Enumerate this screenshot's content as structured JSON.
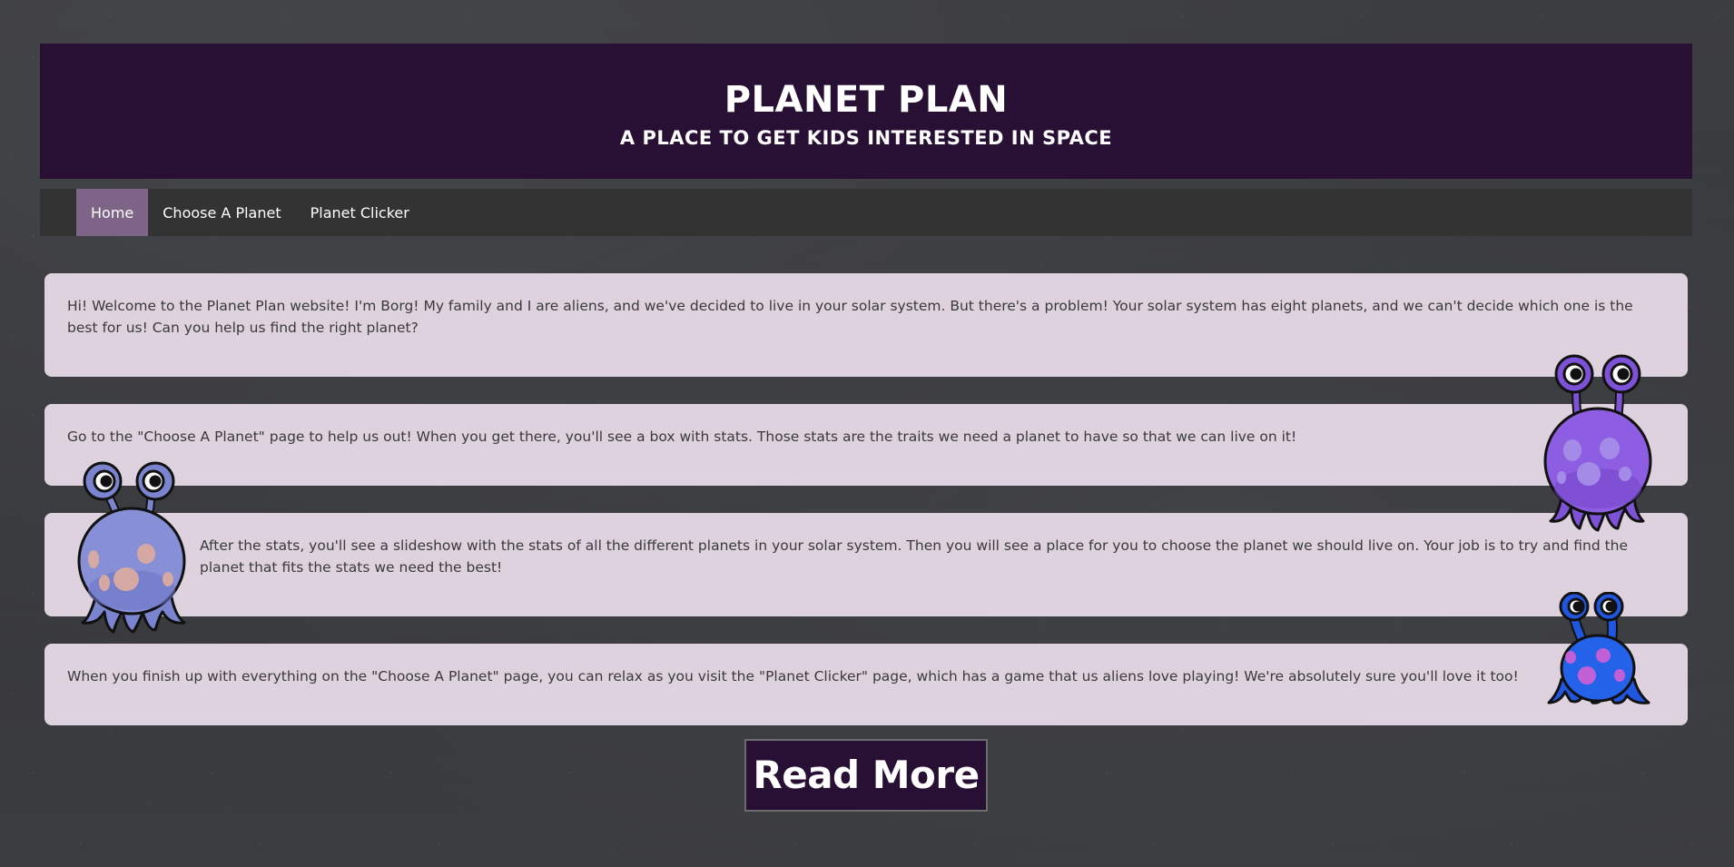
{
  "header": {
    "title": "PLANET PLAN",
    "subtitle": "A PLACE TO GET KIDS INTERESTED IN SPACE"
  },
  "nav": {
    "items": [
      {
        "label": "Home",
        "active": true
      },
      {
        "label": "Choose A Planet",
        "active": false
      },
      {
        "label": "Planet Clicker",
        "active": false
      }
    ]
  },
  "content": {
    "paragraphs": [
      "Hi! Welcome to the Planet Plan website! I'm Borg! My family and I are aliens, and we've decided to live in your solar system. But there's a problem! Your solar system has eight planets, and we can't decide which one is the best for us! Can you help us find the right planet?",
      "Go to the \"Choose A Planet\" page to help us out! When you get there, you'll see a box with stats. Those stats are the traits we need a planet to have so that we can live on it!",
      "After the stats, you'll see a slideshow with the stats of all the different planets in your solar system. Then you will see a place for you to choose the planet we should live on. Your job is to try and find the planet that fits the stats we need the best!",
      "When you finish up with everything on the \"Choose A Planet\" page, you can relax as you visit the \"Planet Clicker\" page, which has a game that us aliens love playing! We're absolutely sure you'll love it too!"
    ]
  },
  "cta": {
    "label": "Read More"
  },
  "colors": {
    "header_bg": "#271033",
    "nav_bg": "#333333",
    "nav_active": "#7e6487",
    "card_bg": "#ddd2de",
    "page_bg": "#3a3b3f"
  },
  "illustrations": [
    "alien-purple-icon",
    "alien-periwinkle-icon",
    "alien-blue-icon"
  ]
}
